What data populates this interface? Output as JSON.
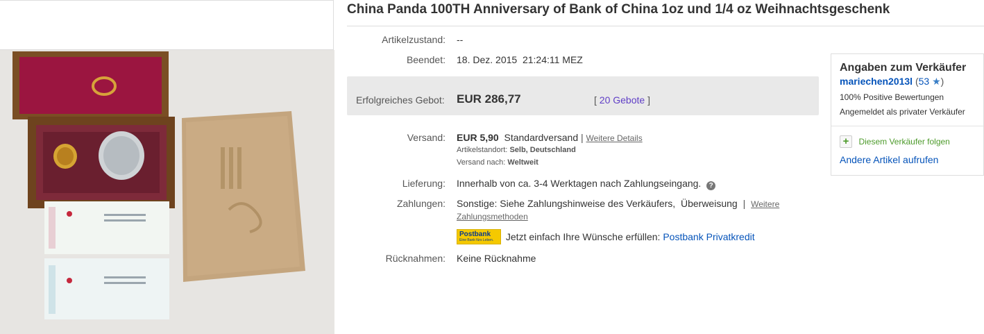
{
  "listing": {
    "title": "China Panda 100TH Anniversary of Bank of China 1oz und 1/4 oz Weihnachtsgeschenk"
  },
  "details": {
    "condition_label": "Artikelzustand:",
    "condition_value": "--",
    "ended_label": "Beendet:",
    "ended_value": "18. Dez. 2015  21:24:11 MEZ",
    "bid_label": "Erfolgreiches Gebot:",
    "bid_value": "EUR 286,77",
    "bids_open": "[",
    "bids_count": "20 Gebote",
    "bids_close": "]",
    "shipping_label": "Versand:",
    "shipping_price": "EUR 5,90",
    "shipping_method": "Standardversand",
    "shipping_sep": "|",
    "shipping_more": "Weitere Details",
    "location_label": "Artikelstandort:",
    "location_value": "Selb, Deutschland",
    "ships_to_label": "Versand nach:",
    "ships_to_value": "Weltweit",
    "delivery_label": "Lieferung:",
    "delivery_value": "Innerhalb von ca. 3-4 Werktagen nach Zahlungseingang.",
    "payments_label": "Zahlungen:",
    "payments_value": "Sonstige: Siehe Zahlungshinweise des Verkäufers,  Überweisung",
    "payments_sep": "|",
    "payments_more_1": "Weitere",
    "payments_more_2": "Zahlungsmethoden",
    "postbank_logo_text": "Postbank",
    "postbank_logo_sub": "Eine Bank fürs Leben.",
    "postbank_promo": "Jetzt einfach Ihre Wünsche erfüllen:",
    "postbank_link": "Postbank Privatkredit",
    "returns_label": "Rücknahmen:",
    "returns_value": "Keine Rücknahme"
  },
  "seller": {
    "heading": "Angaben zum Verkäufer",
    "name": "mariechen2013l",
    "score_open": "(",
    "score": "53",
    "score_close": ")",
    "positive": "100% Positive Bewertungen",
    "type": "Angemeldet als privater Verkäufer",
    "follow": "Diesem Verkäufer folgen",
    "other_items": "Andere Artikel aufrufen"
  },
  "colors": {
    "link": "#0654ba",
    "bids_link": "#5f3ec6",
    "follow_green": "#4c9a2a",
    "star_blue": "#3a7fc7"
  }
}
